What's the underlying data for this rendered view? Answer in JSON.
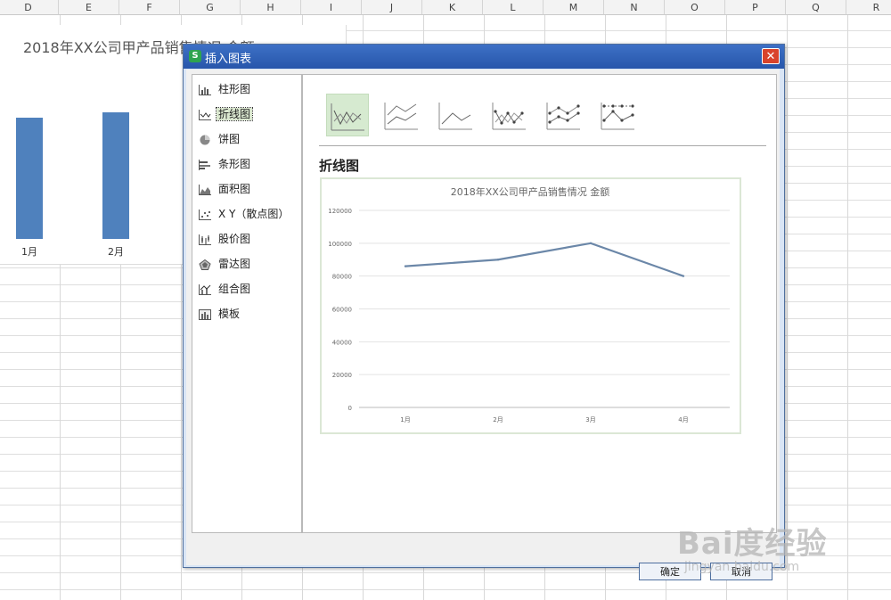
{
  "spreadsheet": {
    "columns": [
      "D",
      "E",
      "F",
      "G",
      "H",
      "I",
      "J",
      "K",
      "L",
      "M",
      "N",
      "O",
      "P",
      "Q",
      "R"
    ],
    "bg_chart": {
      "title": "2018年XX公司甲产品销售情况 金额",
      "bars": [
        {
          "label": "1月"
        },
        {
          "label": "2月"
        }
      ],
      "bar_color": "#4f81bd"
    }
  },
  "dialog": {
    "app_icon": "S",
    "title": "插入图表",
    "close_label": "✕",
    "chart_types": [
      {
        "label": "柱形图",
        "icon": "bar-chart-icon"
      },
      {
        "label": "折线图",
        "icon": "line-chart-icon",
        "selected": true
      },
      {
        "label": "饼图",
        "icon": "pie-chart-icon"
      },
      {
        "label": "条形图",
        "icon": "horizontal-bar-chart-icon"
      },
      {
        "label": "面积图",
        "icon": "area-chart-icon"
      },
      {
        "label": "X Y（散点图）",
        "icon": "scatter-chart-icon"
      },
      {
        "label": "股价图",
        "icon": "stock-chart-icon"
      },
      {
        "label": "雷达图",
        "icon": "radar-chart-icon"
      },
      {
        "label": "组合图",
        "icon": "combo-chart-icon"
      },
      {
        "label": "模板",
        "icon": "template-icon"
      }
    ],
    "sub_types": [
      "line",
      "stacked-line",
      "percent-line",
      "line-markers",
      "stacked-line-markers",
      "percent-line-markers"
    ],
    "preview_title": "折线图",
    "ok_label": "确定",
    "cancel_label": "取消"
  },
  "chart_data": {
    "type": "line",
    "title": "2018年XX公司甲产品销售情况 金额",
    "categories": [
      "1月",
      "2月",
      "3月",
      "4月"
    ],
    "series": [
      {
        "values": [
          86000,
          90000,
          100000,
          80000
        ]
      }
    ],
    "ylim": [
      0,
      120000
    ],
    "yticks": [
      "0",
      "20000",
      "40000",
      "60000",
      "80000",
      "100000",
      "120000"
    ],
    "grid": true,
    "line_color": "#6b87a8"
  },
  "watermark": {
    "main": "Bai度经验",
    "sub": "jingyan.baidu.com"
  }
}
